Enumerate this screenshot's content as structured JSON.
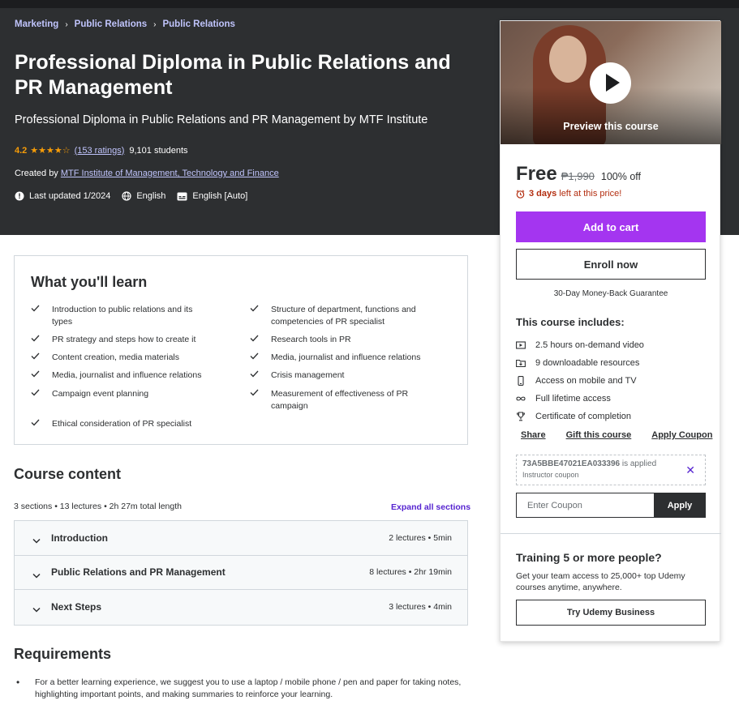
{
  "breadcrumb": [
    "Marketing",
    "Public Relations",
    "Public Relations"
  ],
  "course": {
    "title": "Professional Diploma in Public Relations and PR Management",
    "subtitle": "Professional Diploma in Public Relations and PR Management by MTF Institute",
    "rating": "4.2",
    "stars": "★★★★☆",
    "ratings_count": "(153 ratings)",
    "students": "9,101 students",
    "created_by_label": "Created by",
    "author": "MTF Institute of Management, Technology and Finance",
    "last_updated": "Last updated 1/2024",
    "language": "English",
    "captions": "English [Auto]"
  },
  "sidebar": {
    "preview_label": "Preview this course",
    "price": "Free",
    "original_price": "₱1,990",
    "discount": "100% off",
    "timer_bold": "3 days",
    "timer_text": "left at this price!",
    "add_to_cart": "Add to cart",
    "enroll_now": "Enroll now",
    "guarantee": "30-Day Money-Back Guarantee",
    "includes_title": "This course includes:",
    "includes": [
      {
        "icon": "video-icon",
        "text": "2.5 hours on-demand video"
      },
      {
        "icon": "folder-download-icon",
        "text": "9 downloadable resources"
      },
      {
        "icon": "mobile-icon",
        "text": "Access on mobile and TV"
      },
      {
        "icon": "infinity-icon",
        "text": "Full lifetime access"
      },
      {
        "icon": "trophy-icon",
        "text": "Certificate of completion"
      }
    ],
    "links": {
      "share": "Share",
      "gift": "Gift this course",
      "coupon": "Apply Coupon"
    },
    "applied_coupon": {
      "code": "73A5BBE47021EA033396",
      "status": "is applied",
      "type": "Instructor coupon"
    },
    "coupon_placeholder": "Enter Coupon",
    "apply_label": "Apply",
    "business": {
      "title": "Training 5 or more people?",
      "description": "Get your team access to 25,000+ top Udemy courses anytime, anywhere.",
      "button": "Try Udemy Business"
    }
  },
  "learn": {
    "title": "What you'll learn",
    "items": [
      "Introduction to public relations and its types",
      "Structure of department, functions and competencies of PR specialist",
      "PR strategy and steps how to create it",
      "Research tools in PR",
      "Content creation, media materials",
      "Media, journalist and influence relations",
      "Media, journalist and influence relations",
      "Crisis management",
      "Campaign event planning",
      "Measurement of effectiveness of PR campaign",
      "Ethical consideration of PR specialist"
    ]
  },
  "content": {
    "title": "Course content",
    "meta": "3 sections • 13 lectures • 2h 27m total length",
    "expand_all": "Expand all sections",
    "sections": [
      {
        "title": "Introduction",
        "info": "2 lectures • 5min"
      },
      {
        "title": "Public Relations and PR Management",
        "info": "8 lectures • 2hr 19min"
      },
      {
        "title": "Next Steps",
        "info": "3 lectures • 4min"
      }
    ]
  },
  "requirements": {
    "title": "Requirements",
    "items": [
      "For a better learning experience, we suggest you to use a laptop / mobile phone / pen and paper for taking notes, highlighting important points, and making summaries to reinforce your learning."
    ]
  },
  "colors": {
    "accent": "#a435f0",
    "link_purple": "#5624d0",
    "hero_bg": "#2d2f31",
    "star": "#f69c08",
    "timer": "#b32d0f"
  }
}
